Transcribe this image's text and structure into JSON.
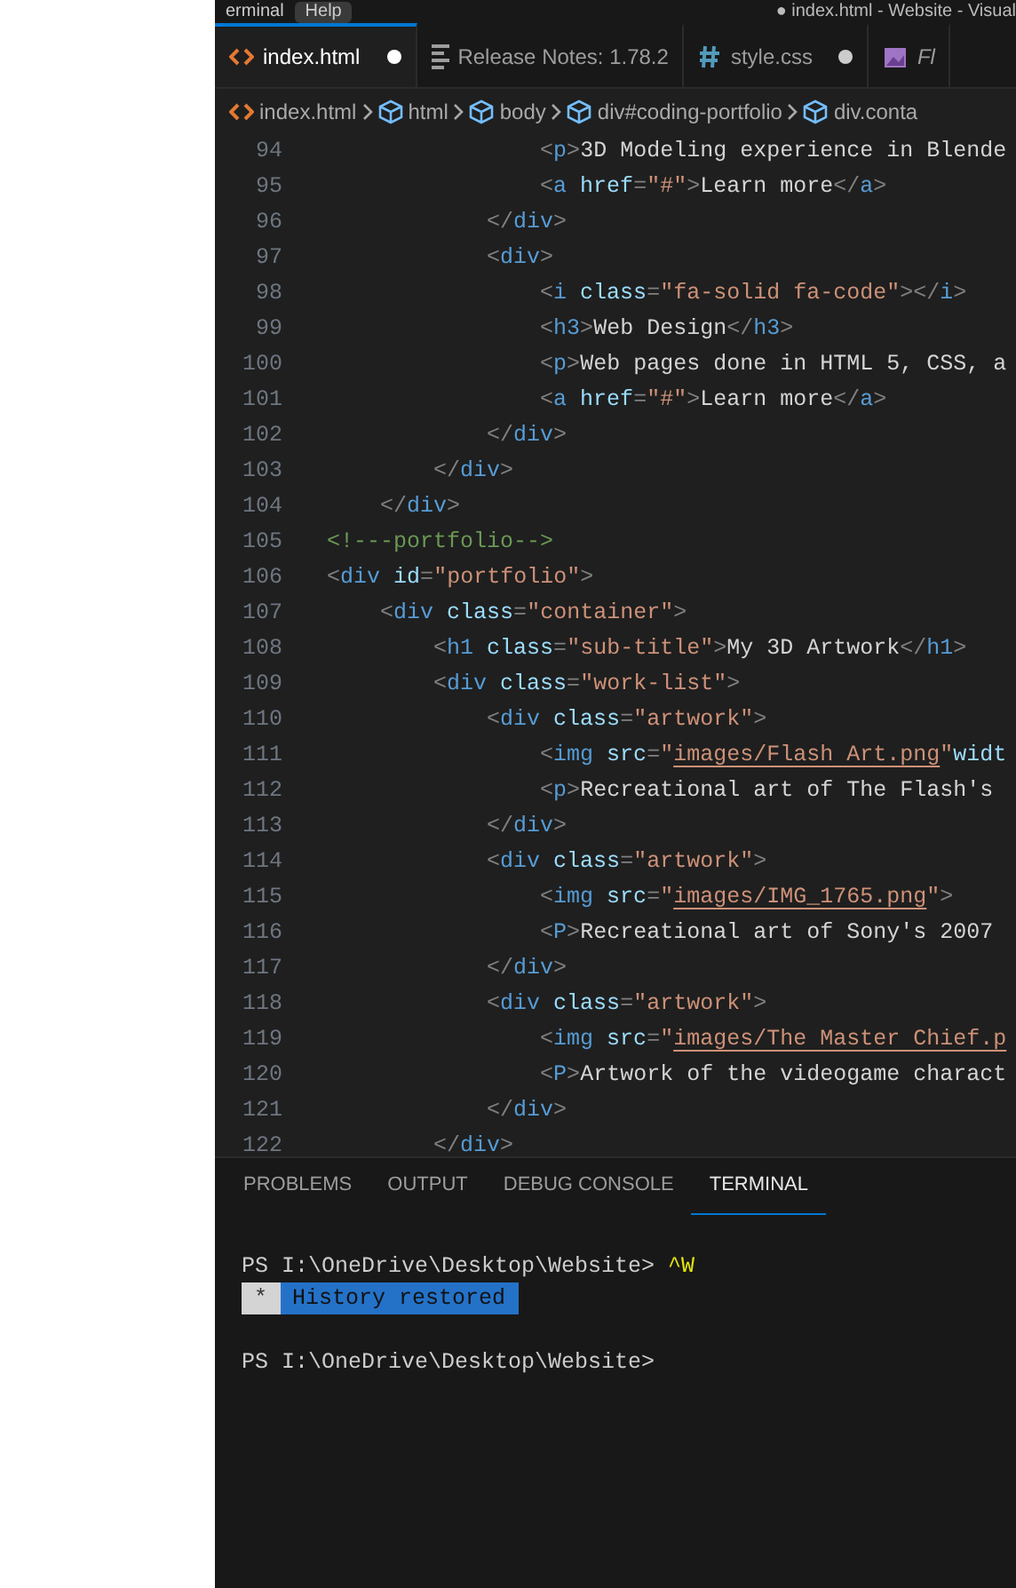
{
  "title_bar": {
    "menus": [
      {
        "label": "erminal",
        "selected": false
      },
      {
        "label": "Help",
        "selected": true
      }
    ],
    "title": "● index.html - Website - Visual"
  },
  "tabs": [
    {
      "label": "index.html",
      "kind": "html",
      "selected": true,
      "modified": true,
      "preview": false
    },
    {
      "label": "Release Notes: 1.78.2",
      "kind": "notes",
      "selected": false,
      "modified": false,
      "preview": false
    },
    {
      "label": "style.css",
      "kind": "css",
      "selected": false,
      "modified": true,
      "preview": false
    },
    {
      "label": "Fl",
      "kind": "image",
      "selected": false,
      "modified": false,
      "preview": true
    }
  ],
  "breadcrumbs": [
    {
      "label": "index.html",
      "kind": "html"
    },
    {
      "label": "html",
      "kind": "element"
    },
    {
      "label": "body",
      "kind": "element"
    },
    {
      "label": "div#coding-portfolio",
      "kind": "element"
    },
    {
      "label": "div.conta",
      "kind": "element"
    }
  ],
  "code_lines": [
    {
      "number": "94",
      "tokens": [
        {
          "kind": "punct",
          "text": "                <"
        },
        {
          "kind": "tag",
          "text": "p"
        },
        {
          "kind": "punct",
          "text": ">"
        },
        {
          "kind": "plain",
          "text": "3D Modeling experience in Blende"
        }
      ]
    },
    {
      "number": "95",
      "tokens": [
        {
          "kind": "punct",
          "text": "                <"
        },
        {
          "kind": "tag",
          "text": "a"
        },
        {
          "kind": "attr",
          "text": " href"
        },
        {
          "kind": "punct",
          "text": "="
        },
        {
          "kind": "string",
          "text": "\"#\""
        },
        {
          "kind": "punct",
          "text": ">"
        },
        {
          "kind": "plain",
          "text": "Learn more"
        },
        {
          "kind": "punct",
          "text": "</"
        },
        {
          "kind": "tag",
          "text": "a"
        },
        {
          "kind": "punct",
          "text": ">"
        }
      ]
    },
    {
      "number": "96",
      "tokens": [
        {
          "kind": "punct",
          "text": "            </"
        },
        {
          "kind": "tag",
          "text": "div"
        },
        {
          "kind": "punct",
          "text": ">"
        }
      ]
    },
    {
      "number": "97",
      "tokens": [
        {
          "kind": "punct",
          "text": "            <"
        },
        {
          "kind": "tag",
          "text": "div"
        },
        {
          "kind": "punct",
          "text": ">"
        }
      ]
    },
    {
      "number": "98",
      "tokens": [
        {
          "kind": "punct",
          "text": "                <"
        },
        {
          "kind": "tag",
          "text": "i"
        },
        {
          "kind": "attr",
          "text": " class"
        },
        {
          "kind": "punct",
          "text": "="
        },
        {
          "kind": "string",
          "text": "\"fa-solid fa-code\""
        },
        {
          "kind": "punct",
          "text": "></"
        },
        {
          "kind": "tag",
          "text": "i"
        },
        {
          "kind": "punct",
          "text": ">"
        }
      ]
    },
    {
      "number": "99",
      "tokens": [
        {
          "kind": "punct",
          "text": "                <"
        },
        {
          "kind": "tag",
          "text": "h3"
        },
        {
          "kind": "punct",
          "text": ">"
        },
        {
          "kind": "plain",
          "text": "Web Design"
        },
        {
          "kind": "punct",
          "text": "</"
        },
        {
          "kind": "tag",
          "text": "h3"
        },
        {
          "kind": "punct",
          "text": ">"
        }
      ]
    },
    {
      "number": "100",
      "tokens": [
        {
          "kind": "punct",
          "text": "                <"
        },
        {
          "kind": "tag",
          "text": "p"
        },
        {
          "kind": "punct",
          "text": ">"
        },
        {
          "kind": "plain",
          "text": "Web pages done in HTML 5, CSS, a"
        }
      ]
    },
    {
      "number": "101",
      "tokens": [
        {
          "kind": "punct",
          "text": "                <"
        },
        {
          "kind": "tag",
          "text": "a"
        },
        {
          "kind": "attr",
          "text": " href"
        },
        {
          "kind": "punct",
          "text": "="
        },
        {
          "kind": "string",
          "text": "\"#\""
        },
        {
          "kind": "punct",
          "text": ">"
        },
        {
          "kind": "plain",
          "text": "Learn more"
        },
        {
          "kind": "punct",
          "text": "</"
        },
        {
          "kind": "tag",
          "text": "a"
        },
        {
          "kind": "punct",
          "text": ">"
        }
      ]
    },
    {
      "number": "102",
      "tokens": [
        {
          "kind": "punct",
          "text": "            </"
        },
        {
          "kind": "tag",
          "text": "div"
        },
        {
          "kind": "punct",
          "text": ">"
        }
      ]
    },
    {
      "number": "103",
      "tokens": [
        {
          "kind": "punct",
          "text": "        </"
        },
        {
          "kind": "tag",
          "text": "div"
        },
        {
          "kind": "punct",
          "text": ">"
        }
      ]
    },
    {
      "number": "104",
      "tokens": [
        {
          "kind": "punct",
          "text": "    </"
        },
        {
          "kind": "tag",
          "text": "div"
        },
        {
          "kind": "punct",
          "text": ">"
        }
      ]
    },
    {
      "number": "105",
      "tokens": [
        {
          "kind": "comment",
          "text": "<!---portfolio-->"
        }
      ]
    },
    {
      "number": "106",
      "tokens": [
        {
          "kind": "punct",
          "text": "<"
        },
        {
          "kind": "tag",
          "text": "div"
        },
        {
          "kind": "attr",
          "text": " id"
        },
        {
          "kind": "punct",
          "text": "="
        },
        {
          "kind": "string",
          "text": "\"portfolio\""
        },
        {
          "kind": "punct",
          "text": ">"
        }
      ]
    },
    {
      "number": "107",
      "tokens": [
        {
          "kind": "punct",
          "text": "    <"
        },
        {
          "kind": "tag",
          "text": "div"
        },
        {
          "kind": "attr",
          "text": " class"
        },
        {
          "kind": "punct",
          "text": "="
        },
        {
          "kind": "string",
          "text": "\"container\""
        },
        {
          "kind": "punct",
          "text": ">"
        }
      ]
    },
    {
      "number": "108",
      "tokens": [
        {
          "kind": "punct",
          "text": "        <"
        },
        {
          "kind": "tag",
          "text": "h1"
        },
        {
          "kind": "attr",
          "text": " class"
        },
        {
          "kind": "punct",
          "text": "="
        },
        {
          "kind": "string",
          "text": "\"sub-title\""
        },
        {
          "kind": "punct",
          "text": ">"
        },
        {
          "kind": "plain",
          "text": "My 3D Artwork"
        },
        {
          "kind": "punct",
          "text": "</"
        },
        {
          "kind": "tag",
          "text": "h1"
        },
        {
          "kind": "punct",
          "text": ">"
        }
      ]
    },
    {
      "number": "109",
      "tokens": [
        {
          "kind": "punct",
          "text": "        <"
        },
        {
          "kind": "tag",
          "text": "div"
        },
        {
          "kind": "attr",
          "text": " class"
        },
        {
          "kind": "punct",
          "text": "="
        },
        {
          "kind": "string",
          "text": "\"work-list\""
        },
        {
          "kind": "punct",
          "text": ">"
        }
      ]
    },
    {
      "number": "110",
      "tokens": [
        {
          "kind": "punct",
          "text": "            <"
        },
        {
          "kind": "tag",
          "text": "div"
        },
        {
          "kind": "attr",
          "text": " class"
        },
        {
          "kind": "punct",
          "text": "="
        },
        {
          "kind": "string",
          "text": "\"artwork\""
        },
        {
          "kind": "punct",
          "text": ">"
        }
      ]
    },
    {
      "number": "111",
      "tokens": [
        {
          "kind": "punct",
          "text": "                <"
        },
        {
          "kind": "tag",
          "text": "img"
        },
        {
          "kind": "attr",
          "text": " src"
        },
        {
          "kind": "punct",
          "text": "="
        },
        {
          "kind": "string",
          "text": "\""
        },
        {
          "kind": "path",
          "text": "images/Flash Art.png"
        },
        {
          "kind": "string",
          "text": "\""
        },
        {
          "kind": "attr",
          "text": "widt"
        }
      ]
    },
    {
      "number": "112",
      "tokens": [
        {
          "kind": "punct",
          "text": "                <"
        },
        {
          "kind": "tag",
          "text": "p"
        },
        {
          "kind": "punct",
          "text": ">"
        },
        {
          "kind": "plain",
          "text": "Recreational art of The Flash's"
        }
      ]
    },
    {
      "number": "113",
      "tokens": [
        {
          "kind": "punct",
          "text": "            </"
        },
        {
          "kind": "tag",
          "text": "div"
        },
        {
          "kind": "punct",
          "text": ">"
        }
      ]
    },
    {
      "number": "114",
      "tokens": [
        {
          "kind": "punct",
          "text": "            <"
        },
        {
          "kind": "tag",
          "text": "div"
        },
        {
          "kind": "attr",
          "text": " class"
        },
        {
          "kind": "punct",
          "text": "="
        },
        {
          "kind": "string",
          "text": "\"artwork\""
        },
        {
          "kind": "punct",
          "text": ">"
        }
      ]
    },
    {
      "number": "115",
      "tokens": [
        {
          "kind": "punct",
          "text": "                <"
        },
        {
          "kind": "tag",
          "text": "img"
        },
        {
          "kind": "attr",
          "text": " src"
        },
        {
          "kind": "punct",
          "text": "="
        },
        {
          "kind": "string",
          "text": "\""
        },
        {
          "kind": "path",
          "text": "images/IMG_1765.png"
        },
        {
          "kind": "string",
          "text": "\""
        },
        {
          "kind": "punct",
          "text": ">"
        }
      ]
    },
    {
      "number": "116",
      "tokens": [
        {
          "kind": "punct",
          "text": "                <"
        },
        {
          "kind": "tag",
          "text": "P"
        },
        {
          "kind": "punct",
          "text": ">"
        },
        {
          "kind": "plain",
          "text": "Recreational art of Sony's 2007"
        }
      ]
    },
    {
      "number": "117",
      "tokens": [
        {
          "kind": "punct",
          "text": "            </"
        },
        {
          "kind": "tag",
          "text": "div"
        },
        {
          "kind": "punct",
          "text": ">"
        }
      ]
    },
    {
      "number": "118",
      "tokens": [
        {
          "kind": "punct",
          "text": "            <"
        },
        {
          "kind": "tag",
          "text": "div"
        },
        {
          "kind": "attr",
          "text": " class"
        },
        {
          "kind": "punct",
          "text": "="
        },
        {
          "kind": "string",
          "text": "\"artwork\""
        },
        {
          "kind": "punct",
          "text": ">"
        }
      ]
    },
    {
      "number": "119",
      "tokens": [
        {
          "kind": "punct",
          "text": "                <"
        },
        {
          "kind": "tag",
          "text": "img"
        },
        {
          "kind": "attr",
          "text": " src"
        },
        {
          "kind": "punct",
          "text": "="
        },
        {
          "kind": "string",
          "text": "\""
        },
        {
          "kind": "path",
          "text": "images/The Master Chief.p"
        }
      ]
    },
    {
      "number": "120",
      "tokens": [
        {
          "kind": "punct",
          "text": "                <"
        },
        {
          "kind": "tag",
          "text": "P"
        },
        {
          "kind": "punct",
          "text": ">"
        },
        {
          "kind": "plain",
          "text": "Artwork of the videogame charact"
        }
      ]
    },
    {
      "number": "121",
      "tokens": [
        {
          "kind": "punct",
          "text": "            </"
        },
        {
          "kind": "tag",
          "text": "div"
        },
        {
          "kind": "punct",
          "text": ">"
        }
      ]
    },
    {
      "number": "122",
      "tokens": [
        {
          "kind": "punct",
          "text": "        </"
        },
        {
          "kind": "tag",
          "text": "div"
        },
        {
          "kind": "punct",
          "text": ">"
        }
      ]
    }
  ],
  "panel_tabs": [
    {
      "label": "PROBLEMS",
      "selected": false
    },
    {
      "label": "OUTPUT",
      "selected": false
    },
    {
      "label": "DEBUG CONSOLE",
      "selected": false
    },
    {
      "label": "TERMINAL",
      "selected": true
    }
  ],
  "terminal": {
    "lines": [
      {
        "kind": "prompt",
        "prompt": "PS I:\\OneDrive\\Desktop\\Website>",
        "input": "^W"
      },
      {
        "kind": "notice",
        "mark": "*",
        "message": "History restored"
      },
      {
        "kind": "blank"
      },
      {
        "kind": "prompt",
        "prompt": "PS I:\\OneDrive\\Desktop\\Website>"
      }
    ]
  }
}
